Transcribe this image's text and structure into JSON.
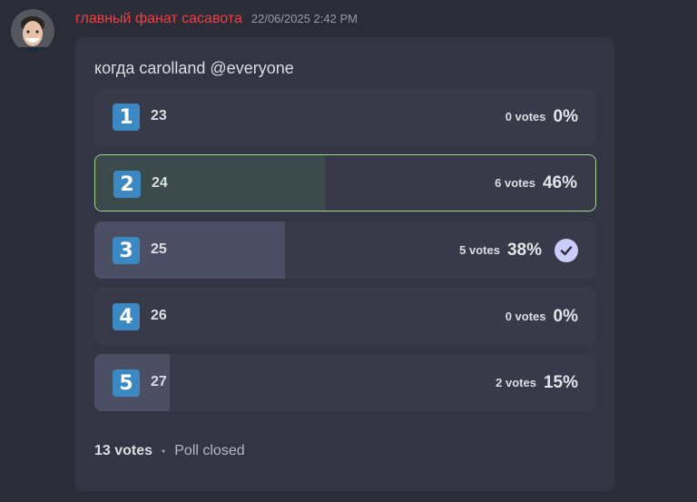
{
  "message": {
    "username": "главный фанат сасавота",
    "timestamp": "22/06/2025 2:42 PM",
    "avatar_icon": "user-avatar",
    "username_color": "#f23f42"
  },
  "poll": {
    "question": "когда carolland @everyone",
    "answers": [
      {
        "emoji": "1",
        "text": "23",
        "votes": "0 votes",
        "percent": "0%",
        "fraction": 0.0
      },
      {
        "emoji": "2",
        "text": "24",
        "votes": "6 votes",
        "percent": "46%",
        "fraction": 0.46,
        "selected": true
      },
      {
        "emoji": "3",
        "text": "25",
        "votes": "5 votes",
        "percent": "38%",
        "fraction": 0.38,
        "winner": true
      },
      {
        "emoji": "4",
        "text": "26",
        "votes": "0 votes",
        "percent": "0%",
        "fraction": 0.0
      },
      {
        "emoji": "5",
        "text": "27",
        "votes": "2 votes",
        "percent": "15%",
        "fraction": 0.15
      }
    ],
    "total_votes": "13 votes",
    "separator": "•",
    "status": "Poll closed"
  },
  "colors": {
    "background": "#2b2c38",
    "card": "#333545",
    "selected_border": "#a4d68a",
    "keycap": "#3b88c3",
    "check": "#c9cdfb"
  }
}
